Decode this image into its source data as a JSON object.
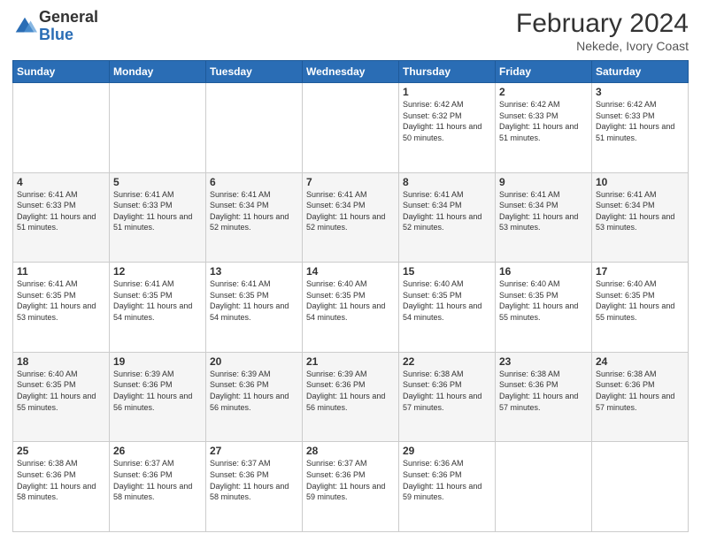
{
  "logo": {
    "general": "General",
    "blue": "Blue"
  },
  "title": {
    "month_year": "February 2024",
    "location": "Nekede, Ivory Coast"
  },
  "weekdays": [
    "Sunday",
    "Monday",
    "Tuesday",
    "Wednesday",
    "Thursday",
    "Friday",
    "Saturday"
  ],
  "weeks": [
    [
      {
        "day": "",
        "info": ""
      },
      {
        "day": "",
        "info": ""
      },
      {
        "day": "",
        "info": ""
      },
      {
        "day": "",
        "info": ""
      },
      {
        "day": "1",
        "info": "Sunrise: 6:42 AM\nSunset: 6:32 PM\nDaylight: 11 hours and 50 minutes."
      },
      {
        "day": "2",
        "info": "Sunrise: 6:42 AM\nSunset: 6:33 PM\nDaylight: 11 hours and 51 minutes."
      },
      {
        "day": "3",
        "info": "Sunrise: 6:42 AM\nSunset: 6:33 PM\nDaylight: 11 hours and 51 minutes."
      }
    ],
    [
      {
        "day": "4",
        "info": "Sunrise: 6:41 AM\nSunset: 6:33 PM\nDaylight: 11 hours and 51 minutes."
      },
      {
        "day": "5",
        "info": "Sunrise: 6:41 AM\nSunset: 6:33 PM\nDaylight: 11 hours and 51 minutes."
      },
      {
        "day": "6",
        "info": "Sunrise: 6:41 AM\nSunset: 6:34 PM\nDaylight: 11 hours and 52 minutes."
      },
      {
        "day": "7",
        "info": "Sunrise: 6:41 AM\nSunset: 6:34 PM\nDaylight: 11 hours and 52 minutes."
      },
      {
        "day": "8",
        "info": "Sunrise: 6:41 AM\nSunset: 6:34 PM\nDaylight: 11 hours and 52 minutes."
      },
      {
        "day": "9",
        "info": "Sunrise: 6:41 AM\nSunset: 6:34 PM\nDaylight: 11 hours and 53 minutes."
      },
      {
        "day": "10",
        "info": "Sunrise: 6:41 AM\nSunset: 6:34 PM\nDaylight: 11 hours and 53 minutes."
      }
    ],
    [
      {
        "day": "11",
        "info": "Sunrise: 6:41 AM\nSunset: 6:35 PM\nDaylight: 11 hours and 53 minutes."
      },
      {
        "day": "12",
        "info": "Sunrise: 6:41 AM\nSunset: 6:35 PM\nDaylight: 11 hours and 54 minutes."
      },
      {
        "day": "13",
        "info": "Sunrise: 6:41 AM\nSunset: 6:35 PM\nDaylight: 11 hours and 54 minutes."
      },
      {
        "day": "14",
        "info": "Sunrise: 6:40 AM\nSunset: 6:35 PM\nDaylight: 11 hours and 54 minutes."
      },
      {
        "day": "15",
        "info": "Sunrise: 6:40 AM\nSunset: 6:35 PM\nDaylight: 11 hours and 54 minutes."
      },
      {
        "day": "16",
        "info": "Sunrise: 6:40 AM\nSunset: 6:35 PM\nDaylight: 11 hours and 55 minutes."
      },
      {
        "day": "17",
        "info": "Sunrise: 6:40 AM\nSunset: 6:35 PM\nDaylight: 11 hours and 55 minutes."
      }
    ],
    [
      {
        "day": "18",
        "info": "Sunrise: 6:40 AM\nSunset: 6:35 PM\nDaylight: 11 hours and 55 minutes."
      },
      {
        "day": "19",
        "info": "Sunrise: 6:39 AM\nSunset: 6:36 PM\nDaylight: 11 hours and 56 minutes."
      },
      {
        "day": "20",
        "info": "Sunrise: 6:39 AM\nSunset: 6:36 PM\nDaylight: 11 hours and 56 minutes."
      },
      {
        "day": "21",
        "info": "Sunrise: 6:39 AM\nSunset: 6:36 PM\nDaylight: 11 hours and 56 minutes."
      },
      {
        "day": "22",
        "info": "Sunrise: 6:38 AM\nSunset: 6:36 PM\nDaylight: 11 hours and 57 minutes."
      },
      {
        "day": "23",
        "info": "Sunrise: 6:38 AM\nSunset: 6:36 PM\nDaylight: 11 hours and 57 minutes."
      },
      {
        "day": "24",
        "info": "Sunrise: 6:38 AM\nSunset: 6:36 PM\nDaylight: 11 hours and 57 minutes."
      }
    ],
    [
      {
        "day": "25",
        "info": "Sunrise: 6:38 AM\nSunset: 6:36 PM\nDaylight: 11 hours and 58 minutes."
      },
      {
        "day": "26",
        "info": "Sunrise: 6:37 AM\nSunset: 6:36 PM\nDaylight: 11 hours and 58 minutes."
      },
      {
        "day": "27",
        "info": "Sunrise: 6:37 AM\nSunset: 6:36 PM\nDaylight: 11 hours and 58 minutes."
      },
      {
        "day": "28",
        "info": "Sunrise: 6:37 AM\nSunset: 6:36 PM\nDaylight: 11 hours and 59 minutes."
      },
      {
        "day": "29",
        "info": "Sunrise: 6:36 AM\nSunset: 6:36 PM\nDaylight: 11 hours and 59 minutes."
      },
      {
        "day": "",
        "info": ""
      },
      {
        "day": "",
        "info": ""
      }
    ]
  ]
}
